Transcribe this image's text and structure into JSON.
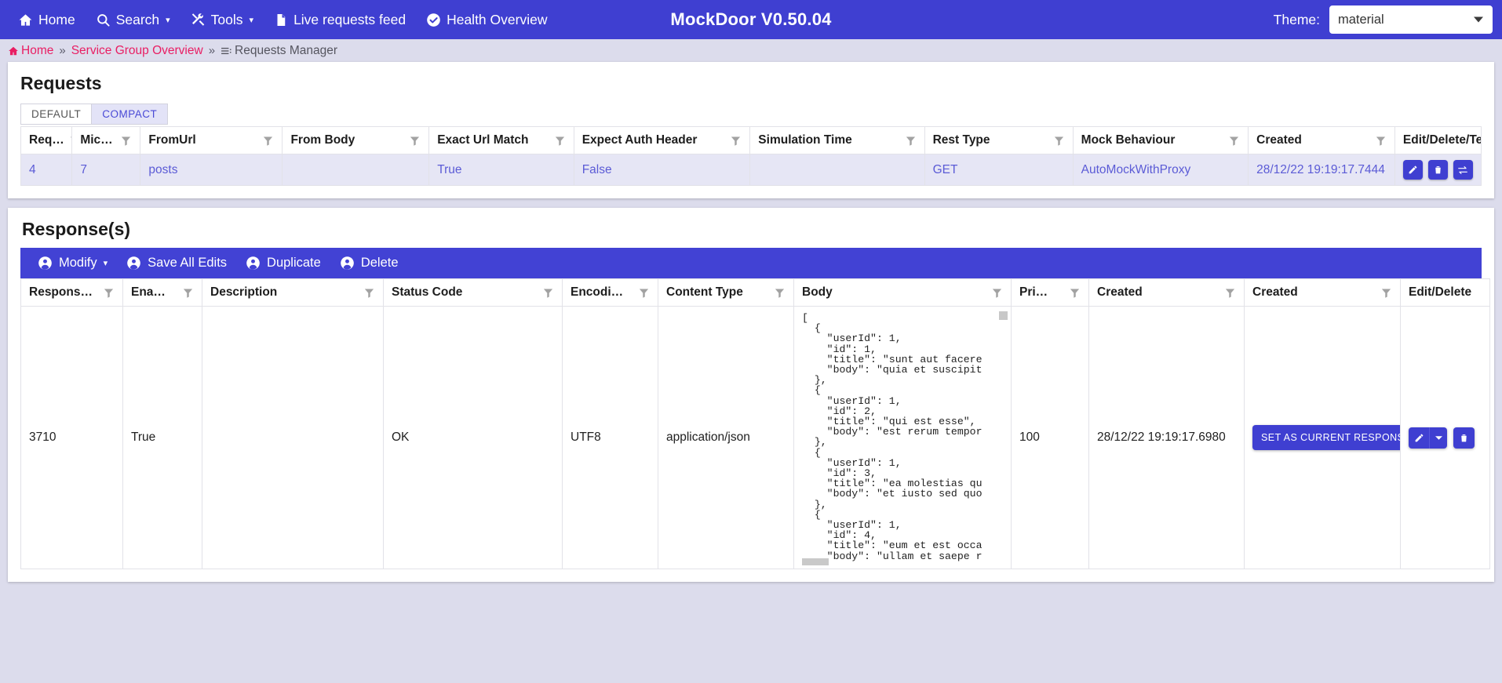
{
  "navbar": {
    "items": [
      {
        "label": "Home",
        "icon": "home-icon",
        "caret": false
      },
      {
        "label": "Search",
        "icon": "search-icon",
        "caret": true
      },
      {
        "label": "Tools",
        "icon": "tools-icon",
        "caret": true
      },
      {
        "label": "Live requests feed",
        "icon": "document-icon",
        "caret": false
      },
      {
        "label": "Health Overview",
        "icon": "check-circle-icon",
        "caret": false
      }
    ],
    "caret_glyph": "▾",
    "brand": "MockDoor V0.50.04",
    "theme_label": "Theme:",
    "theme_value": "material",
    "theme_options": [
      "material"
    ]
  },
  "breadcrumb": {
    "home": "Home",
    "separator": "»",
    "group": "Service Group Overview",
    "current": "Requests Manager"
  },
  "requests": {
    "title": "Requests",
    "tabs": [
      {
        "label": "DEFAULT",
        "active": false
      },
      {
        "label": "COMPACT",
        "active": true
      }
    ],
    "columns": [
      {
        "label": "Req…",
        "filter": true
      },
      {
        "label": "Mic…",
        "filter": true
      },
      {
        "label": "FromUrl",
        "filter": true
      },
      {
        "label": "From Body",
        "filter": true
      },
      {
        "label": "Exact Url Match",
        "filter": true
      },
      {
        "label": "Expect Auth Header",
        "filter": true
      },
      {
        "label": "Simulation Time",
        "filter": true
      },
      {
        "label": "Rest Type",
        "filter": true
      },
      {
        "label": "Mock Behaviour",
        "filter": true
      },
      {
        "label": "Created",
        "filter": true
      },
      {
        "label": "Edit/Delete/Test",
        "filter": false
      }
    ],
    "rows": [
      {
        "req_id": "4",
        "mic": "7",
        "from_url": "posts",
        "from_body": "",
        "exact_url_match": "True",
        "expect_auth_header": "False",
        "simulation_time": "",
        "rest_type": "GET",
        "mock_behaviour": "AutoMockWithProxy",
        "created": "28/12/22 19:19:17.7444",
        "actions": [
          "edit-icon",
          "delete-icon",
          "test-icon"
        ]
      }
    ]
  },
  "responses": {
    "title": "Response(s)",
    "toolbar": [
      {
        "label": "Modify",
        "icon": "user-icon",
        "caret": true
      },
      {
        "label": "Save All Edits",
        "icon": "user-icon",
        "caret": false
      },
      {
        "label": "Duplicate",
        "icon": "user-icon",
        "caret": false
      },
      {
        "label": "Delete",
        "icon": "user-icon",
        "caret": false
      }
    ],
    "toolbar_caret": "▾",
    "columns": [
      {
        "label": "Respons…",
        "filter": true
      },
      {
        "label": "Ena…",
        "filter": true
      },
      {
        "label": "Description",
        "filter": true
      },
      {
        "label": "Status Code",
        "filter": true
      },
      {
        "label": "Encodi…",
        "filter": true
      },
      {
        "label": "Content Type",
        "filter": true
      },
      {
        "label": "Body",
        "filter": true
      },
      {
        "label": "Pri…",
        "filter": true
      },
      {
        "label": "Created",
        "filter": true
      },
      {
        "label": "Created",
        "filter": true
      },
      {
        "label": "Edit/Delete",
        "filter": false
      }
    ],
    "rows": [
      {
        "response_id": "3710",
        "enabled": "True",
        "description": "",
        "status_code": "OK",
        "encoding": "UTF8",
        "content_type": "application/json",
        "body": "[\n  {\n    \"userId\": 1,\n    \"id\": 1,\n    \"title\": \"sunt aut facere\n    \"body\": \"quia et suscipit\n  },\n  {\n    \"userId\": 1,\n    \"id\": 2,\n    \"title\": \"qui est esse\",\n    \"body\": \"est rerum tempor\n  },\n  {\n    \"userId\": 1,\n    \"id\": 3,\n    \"title\": \"ea molestias qu\n    \"body\": \"et iusto sed quo\n  },\n  {\n    \"userId\": 1,\n    \"id\": 4,\n    \"title\": \"eum et est occa\n    \"body\": \"ullam et saepe r",
        "priority": "100",
        "created": "28/12/22 19:19:17.6980",
        "set_current_label": "SET AS CURRENT RESPONSE",
        "actions": [
          "edit-icon",
          "dropdown-icon",
          "delete-icon"
        ]
      }
    ]
  },
  "colors": {
    "primary": "#3f3fd1",
    "toolbar": "#4242d4",
    "link": "#5b5bd6",
    "breadcrumb_link": "#e91e63",
    "row_bg": "#e6e6f5",
    "page_bg": "#dcdcec"
  }
}
